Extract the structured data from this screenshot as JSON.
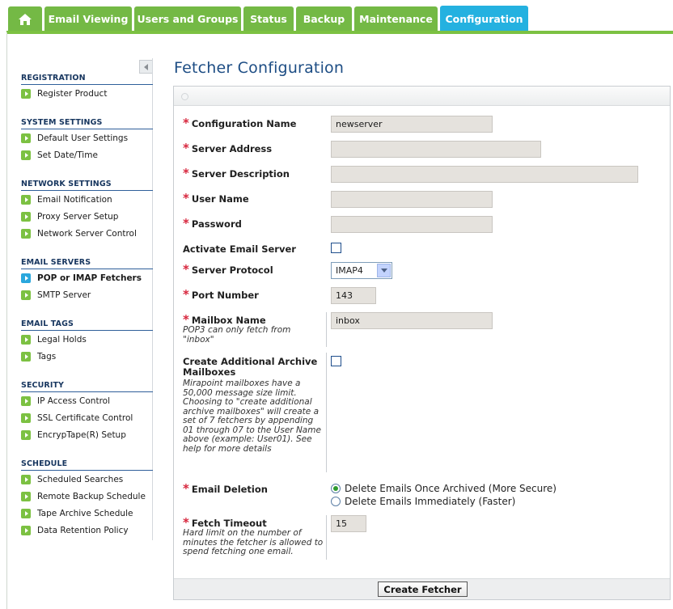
{
  "tabs": [
    {
      "label": "Email Viewing"
    },
    {
      "label": "Users and Groups"
    },
    {
      "label": "Status"
    },
    {
      "label": "Backup"
    },
    {
      "label": "Maintenance"
    },
    {
      "label": "Configuration",
      "active": true
    }
  ],
  "home_icon": "home-icon",
  "sidebar": {
    "sections": [
      {
        "title": "REGISTRATION",
        "items": [
          "Register Product"
        ]
      },
      {
        "title": "SYSTEM SETTINGS",
        "items": [
          "Default User Settings",
          "Set Date/Time"
        ]
      },
      {
        "title": "NETWORK SETTINGS",
        "items": [
          "Email Notification",
          "Proxy Server Setup",
          "Network Server Control"
        ]
      },
      {
        "title": "EMAIL SERVERS",
        "items": [
          "POP or IMAP Fetchers",
          "SMTP Server"
        ],
        "active_item": "POP or IMAP Fetchers"
      },
      {
        "title": "EMAIL TAGS",
        "items": [
          "Legal Holds",
          "Tags"
        ]
      },
      {
        "title": "SECURITY",
        "items": [
          "IP Access Control",
          "SSL Certificate Control",
          "EncrypTape(R) Setup"
        ]
      },
      {
        "title": "SCHEDULE",
        "items": [
          "Scheduled Searches",
          "Remote Backup Schedule",
          "Tape Archive Schedule",
          "Data Retention Policy"
        ]
      }
    ]
  },
  "page": {
    "title": "Fetcher Configuration"
  },
  "form": {
    "config_name": {
      "label": "Configuration Name",
      "value": "newserver"
    },
    "server_address": {
      "label": "Server Address",
      "value": ""
    },
    "server_description": {
      "label": "Server Description",
      "value": ""
    },
    "user_name": {
      "label": "User Name",
      "value": ""
    },
    "password": {
      "label": "Password",
      "value": ""
    },
    "activate": {
      "label": "Activate Email Server",
      "checked": false
    },
    "protocol": {
      "label": "Server Protocol",
      "value": "IMAP4"
    },
    "port": {
      "label": "Port Number",
      "value": "143"
    },
    "mailbox": {
      "label": "Mailbox Name",
      "note": "POP3 can only fetch from \"inbox\"",
      "value": "inbox"
    },
    "archive": {
      "label": "Create Additional Archive Mailboxes",
      "note": "Mirapoint mailboxes have a 50,000 message size limit. Choosing to \"create additional archive mailboxes\" will create a set of 7 fetchers by appending 01 through 07 to the User Name above (example: User01). See help for more details",
      "checked": false
    },
    "deletion": {
      "label": "Email Deletion",
      "options": [
        "Delete Emails Once Archived (More Secure)",
        "Delete Emails Immediately (Faster)"
      ],
      "selected": 0
    },
    "timeout": {
      "label": "Fetch Timeout",
      "note": "Hard limit on the number of minutes the fetcher is allowed to spend fetching one email.",
      "value": "15"
    },
    "submit_label": "Create Fetcher"
  },
  "colors": {
    "tab": "#74b945",
    "tab_active": "#24b1e0",
    "heading": "#1d4d84",
    "required": "#d7263d"
  }
}
